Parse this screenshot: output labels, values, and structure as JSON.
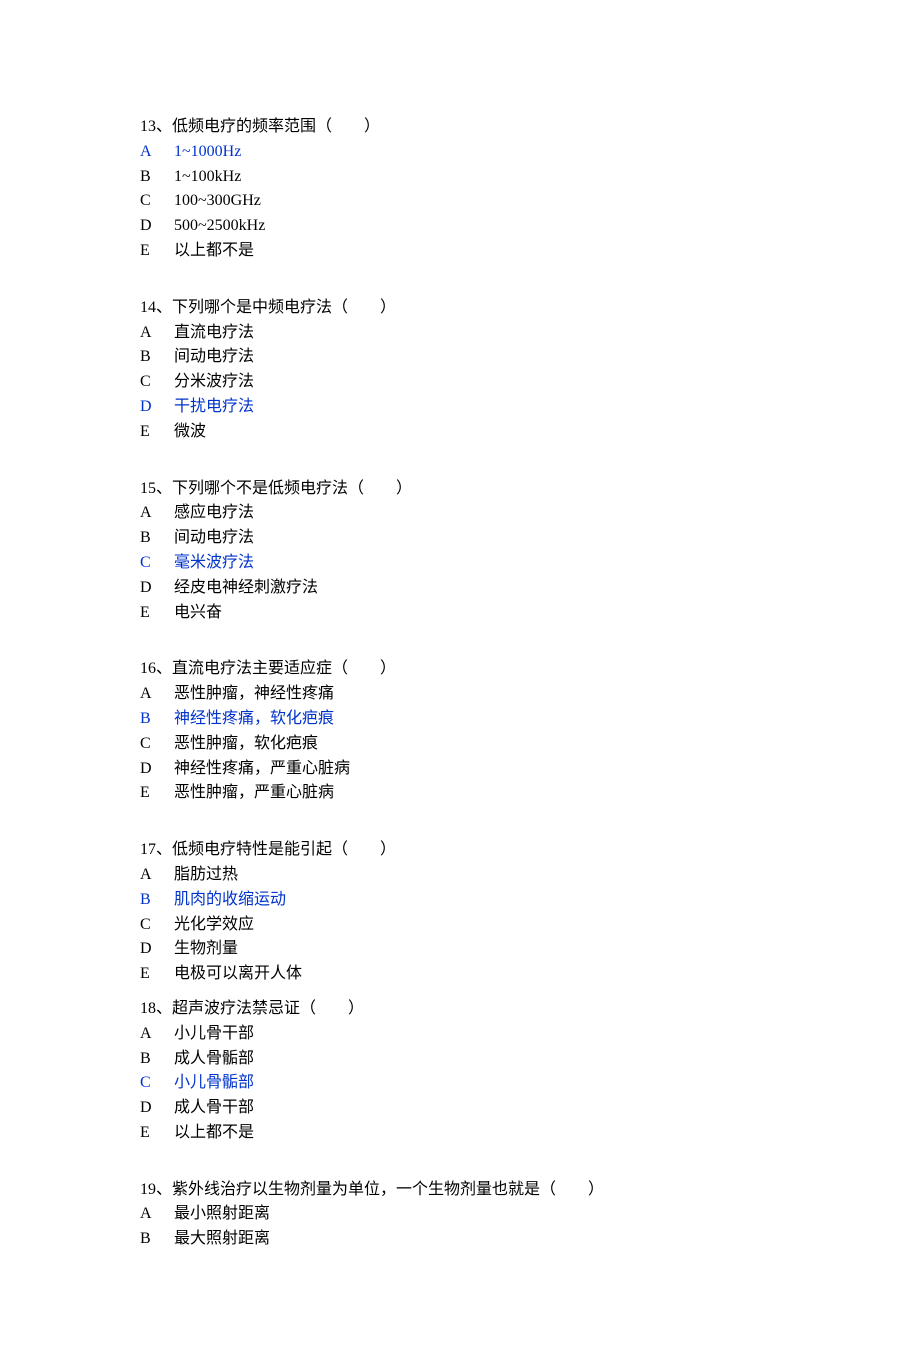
{
  "questions": [
    {
      "stem": "13、低频电疗的频率范围（　　）",
      "options": [
        {
          "letter": "A",
          "text": "1~1000Hz",
          "highlight": true
        },
        {
          "letter": "B",
          "text": "1~100kHz",
          "highlight": false
        },
        {
          "letter": "C",
          "text": "100~300GHz",
          "highlight": false
        },
        {
          "letter": "D",
          "text": "500~2500kHz",
          "highlight": false
        },
        {
          "letter": "E",
          "text": "以上都不是",
          "highlight": false
        }
      ],
      "gap_after": true
    },
    {
      "stem": "14、下列哪个是中频电疗法（　　）",
      "options": [
        {
          "letter": "A",
          "text": "直流电疗法",
          "highlight": false
        },
        {
          "letter": "B",
          "text": "间动电疗法",
          "highlight": false
        },
        {
          "letter": "C",
          "text": "分米波疗法",
          "highlight": false
        },
        {
          "letter": "D",
          "text": "干扰电疗法",
          "highlight": true
        },
        {
          "letter": "E",
          "text": "微波",
          "highlight": false
        }
      ],
      "gap_after": true
    },
    {
      "stem": "15、下列哪个不是低频电疗法（　　）",
      "options": [
        {
          "letter": "A",
          "text": "感应电疗法",
          "highlight": false
        },
        {
          "letter": "B",
          "text": "间动电疗法",
          "highlight": false
        },
        {
          "letter": "C",
          "text": "毫米波疗法",
          "highlight": true
        },
        {
          "letter": "D",
          "text": "经皮电神经刺激疗法",
          "highlight": false
        },
        {
          "letter": "E",
          "text": "电兴奋",
          "highlight": false
        }
      ],
      "gap_after": true
    },
    {
      "stem": "16、直流电疗法主要适应症（　　）",
      "options": [
        {
          "letter": "A",
          "text": "恶性肿瘤，神经性疼痛",
          "highlight": false
        },
        {
          "letter": "B",
          "text": "神经性疼痛，软化疤痕",
          "highlight": true
        },
        {
          "letter": "C",
          "text": "恶性肿瘤，软化疤痕",
          "highlight": false
        },
        {
          "letter": "D",
          "text": "神经性疼痛，严重心脏病",
          "highlight": false
        },
        {
          "letter": "E",
          "text": "恶性肿瘤，严重心脏病",
          "highlight": false
        }
      ],
      "gap_after": true
    },
    {
      "stem": "17、低频电疗特性是能引起（　　）",
      "options": [
        {
          "letter": "A",
          "text": "脂肪过热",
          "highlight": false
        },
        {
          "letter": "B",
          "text": "肌肉的收缩运动",
          "highlight": true
        },
        {
          "letter": "C",
          "text": "光化学效应",
          "highlight": false
        },
        {
          "letter": "D",
          "text": "生物剂量",
          "highlight": false
        },
        {
          "letter": "E",
          "text": "电极可以离开人体",
          "highlight": false
        }
      ],
      "gap_after": false
    },
    {
      "stem": "18、超声波疗法禁忌证（　　）",
      "options": [
        {
          "letter": "A",
          "text": "小儿骨干部",
          "highlight": false
        },
        {
          "letter": "B",
          "text": "成人骨骺部",
          "highlight": false
        },
        {
          "letter": "C",
          "text": "小儿骨骺部",
          "highlight": true
        },
        {
          "letter": "D",
          "text": "成人骨干部",
          "highlight": false
        },
        {
          "letter": "E",
          "text": "以上都不是",
          "highlight": false
        }
      ],
      "gap_after": true
    },
    {
      "stem": "19、紫外线治疗以生物剂量为单位，一个生物剂量也就是（　　）",
      "options": [
        {
          "letter": "A",
          "text": "最小照射距离",
          "highlight": false
        },
        {
          "letter": "B",
          "text": "最大照射距离",
          "highlight": false
        }
      ],
      "gap_after": false
    }
  ]
}
